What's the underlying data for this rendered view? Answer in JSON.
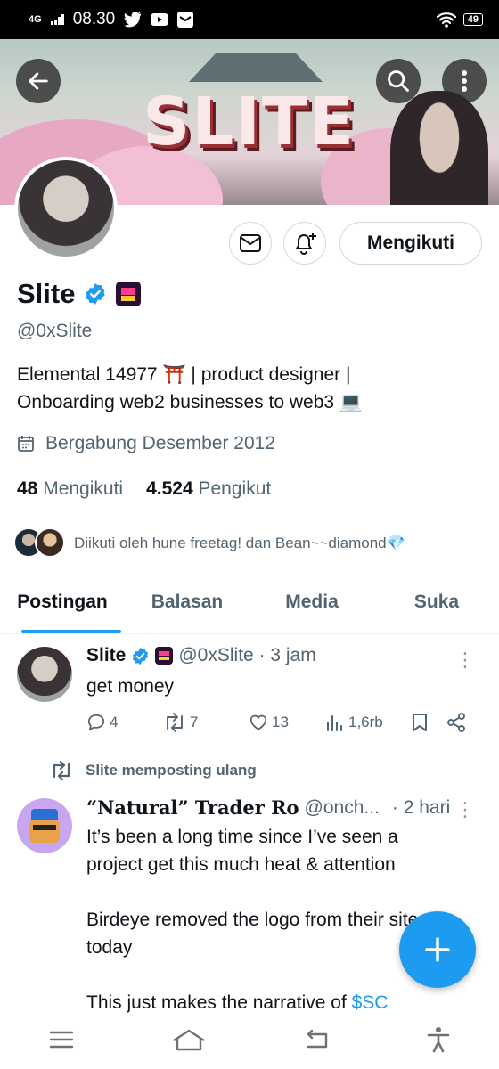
{
  "status_bar": {
    "network": "4G",
    "time": "08.30",
    "battery": "49"
  },
  "banner": {
    "title": "SLITE"
  },
  "profile": {
    "name": "Slite",
    "handle": "@0xSlite",
    "bio_line1": "Elemental 14977 ⛩️ | product designer |",
    "bio_line2": "Onboarding web2 businesses to web3 💻",
    "joined": "Bergabung Desember 2012",
    "following_count": "48",
    "following_label": "Mengikuti",
    "followers_count": "4.524",
    "followers_label": "Pengikut",
    "followed_by": "Diikuti oleh hune freetag! dan Bean~~diamond💎",
    "follow_button": "Mengikuti"
  },
  "tabs": [
    {
      "label": "Postingan"
    },
    {
      "label": "Balasan"
    },
    {
      "label": "Media"
    },
    {
      "label": "Suka"
    }
  ],
  "post1": {
    "name": "Slite",
    "handle_time": "@0xSlite · 3 jam",
    "text": "get money",
    "replies": "4",
    "reposts": "7",
    "likes": "13",
    "views": "1,6rb"
  },
  "post2": {
    "repost_label": "Slite memposting ulang",
    "name": "“Natural” Trader Ro",
    "handle": "@onch...",
    "time": "· 2 hari",
    "line1": "It’s been a long time since I’ve seen a",
    "line2": "project get this much heat & attention",
    "line3": "Birdeye removed the logo from their site",
    "line4": "today",
    "line5_prefix": "This just makes the narrative of ",
    "line5_link": "$SC"
  },
  "colors": {
    "accent": "#1d9bf0",
    "text": "#0f1419",
    "muted": "#536471",
    "border": "#cfd9de"
  },
  "icons": [
    "back-arrow-icon",
    "search-icon",
    "more-icon",
    "message-icon",
    "bell-plus-icon",
    "verified-badge-icon",
    "calendar-icon",
    "reply-icon",
    "repost-icon",
    "like-icon",
    "views-icon",
    "bookmark-icon",
    "share-icon",
    "plus-icon",
    "menu-icon",
    "home-icon",
    "back-icon",
    "accessibility-icon"
  ]
}
